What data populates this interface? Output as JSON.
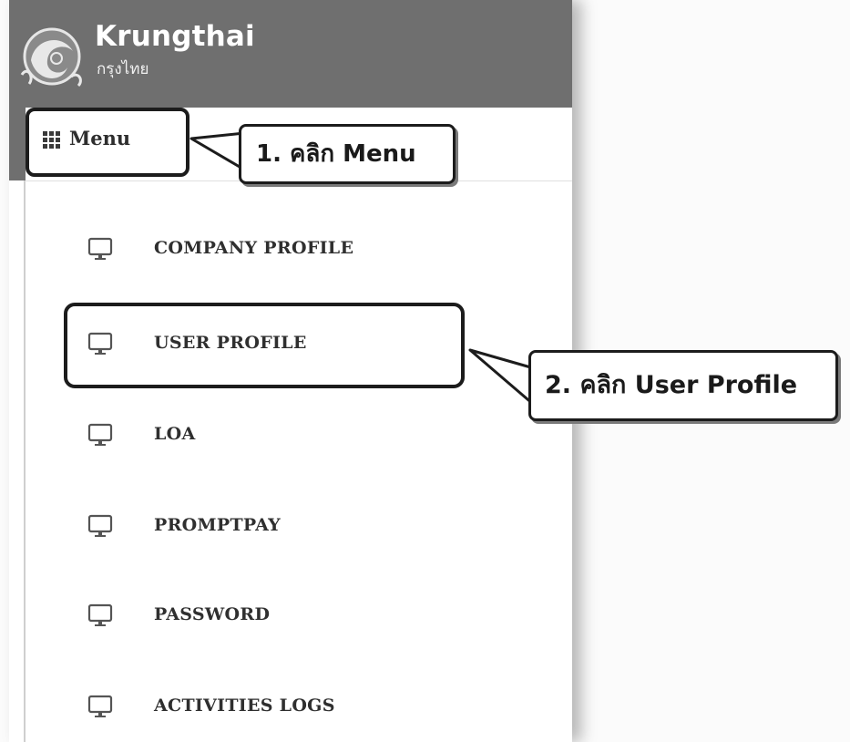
{
  "header": {
    "brand_name": "Krungthai",
    "brand_sub": "กรุงไทย"
  },
  "menu": {
    "label": "Menu",
    "icon": "grid-icon"
  },
  "menu_items": [
    {
      "label": "COMPANY PROFILE",
      "icon": "monitor-icon"
    },
    {
      "label": "USER PROFILE",
      "icon": "monitor-icon",
      "highlighted": true
    },
    {
      "label": "LOA",
      "icon": "monitor-icon"
    },
    {
      "label": "PROMPTPAY",
      "icon": "monitor-icon"
    },
    {
      "label": "PASSWORD",
      "icon": "monitor-icon"
    },
    {
      "label": "ACTIVITIES LOGS",
      "icon": "monitor-icon"
    }
  ],
  "callouts": [
    {
      "text": "1. คลิก Menu"
    },
    {
      "text": "2. คลิก User Profile"
    }
  ],
  "colors": {
    "header_bg": "#6f6f6f",
    "outline": "#1c1c1c",
    "text": "#2f2f2f"
  }
}
